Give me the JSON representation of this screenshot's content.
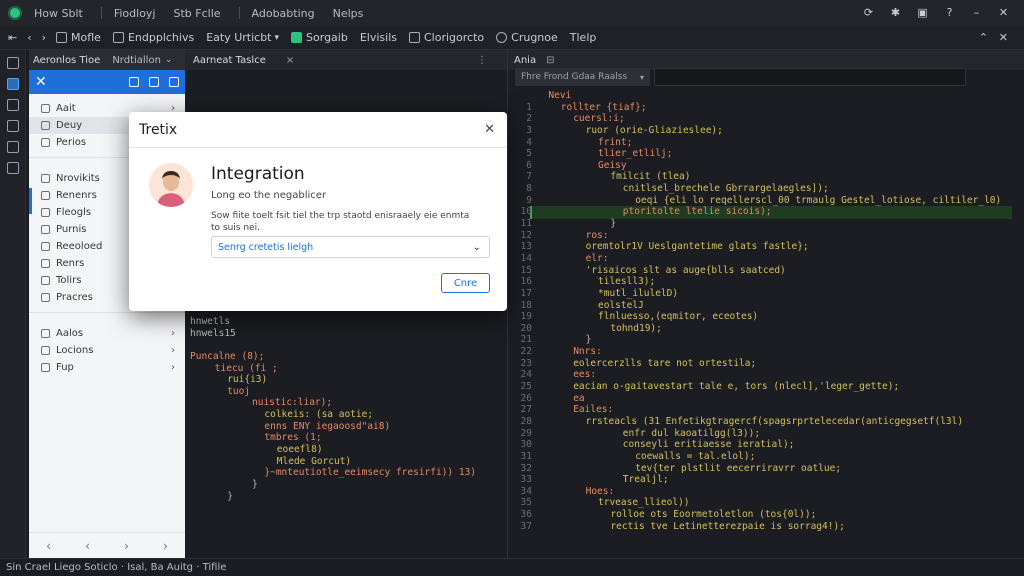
{
  "menubar": {
    "items": [
      "How Sblt",
      "Fiodloyj",
      "Stb Fclle",
      "Adobabting",
      "Nelps"
    ]
  },
  "toolbar": {
    "items": [
      "Mofle",
      "Endpplchivs",
      "Eaty Urticbt",
      "Sorgaib",
      "Elvisils",
      "Clorigorcto",
      "Crugnoe",
      "Tlelp"
    ]
  },
  "left_panel": {
    "tab1": "Aeronlos Tioe",
    "tab2": "Nrdtiallon",
    "items_a": [
      "Aait",
      "Deuy",
      "Perios"
    ],
    "items_b": [
      "Nrovikits",
      "Renenrs",
      "Fleogls",
      "Purnis",
      "Reeoloed",
      "Renrs",
      "Tolirs",
      "Pracres"
    ],
    "items_c": [
      "Aalos",
      "Locions",
      "Fup"
    ]
  },
  "mid_pane": {
    "tab": "Aarneat Taslce",
    "code": [
      {
        "t": "hnwetls",
        "i": 0,
        "c": "#b7bbc2"
      },
      {
        "t": "hnwels15",
        "i": 0,
        "c": "#b7bbc2"
      },
      {
        "t": "",
        "i": 0,
        "c": "#b7bbc2"
      },
      {
        "t": "Puncalne (8);",
        "i": 0,
        "c": "#e58b62"
      },
      {
        "t": "tiecu (fi ;",
        "i": 2,
        "c": "#e58b62"
      },
      {
        "t": "rui{i3)",
        "i": 3,
        "c": "#d4c05a"
      },
      {
        "t": "tuoj",
        "i": 3,
        "c": "#e58b62"
      },
      {
        "t": "nuistic:liar);",
        "i": 5,
        "c": "#e58b62"
      },
      {
        "t": "colkeis: (sa aotie;",
        "i": 6,
        "c": "#d4c05a"
      },
      {
        "t": "enns ENY iegaoosd\"ai8)",
        "i": 6,
        "c": "#e58b62"
      },
      {
        "t": "tmbres (1;",
        "i": 6,
        "c": "#e58b62"
      },
      {
        "t": "eoeefl8)",
        "i": 7,
        "c": "#d4c05a"
      },
      {
        "t": "Mlede Gorcut)",
        "i": 7,
        "c": "#d4c05a"
      },
      {
        "t": "}~mnteutiotle_eeimsecy fresirfi)) 13)",
        "i": 6,
        "c": "#e58b62"
      },
      {
        "t": "}",
        "i": 5,
        "c": "#b7bbc2"
      },
      {
        "t": "}",
        "i": 3,
        "c": "#b7bbc2"
      }
    ]
  },
  "right_pane": {
    "tab": "Ania",
    "filter_label": "Fhre Frond Gdaa Raalss",
    "code": [
      {
        "n": "",
        "t": "Nevi",
        "i": 1,
        "c": "#e58b62"
      },
      {
        "n": "1",
        "t": "rollter {tiaf};",
        "i": 2,
        "c": "#e58b62"
      },
      {
        "n": "2",
        "t": "cuersl:i;",
        "i": 3,
        "c": "#e58b62"
      },
      {
        "n": "3",
        "t": "ruor (orie-Gliazieslee);",
        "i": 4,
        "c": "#d4c05a"
      },
      {
        "n": "4",
        "t": "frint;",
        "i": 5,
        "c": "#e58b62"
      },
      {
        "n": "5",
        "t": "tlier_etlilj;",
        "i": 5,
        "c": "#e58b62"
      },
      {
        "n": "6",
        "t": "Geisy",
        "i": 5,
        "c": "#e58b62"
      },
      {
        "n": "7",
        "t": "fmilcit (tlea)",
        "i": 6,
        "c": "#d4c05a"
      },
      {
        "n": "8",
        "t": "cnitlsel_brechele Gbrrargelaegles]);",
        "i": 7,
        "c": "#d4c05a"
      },
      {
        "n": "9",
        "t": "oeqi {eli lo reqellerscl_00 trmaulg Gestel_lotiose, ciltiler_l0)",
        "i": 8,
        "c": "#d4c05a"
      },
      {
        "n": "10",
        "t": "ptoritolte ltelie sicois);",
        "i": 7,
        "c": "#e58b62"
      },
      {
        "n": "11",
        "t": "}",
        "i": 6,
        "c": "#b7bbc2"
      },
      {
        "n": "12",
        "t": "ros:",
        "i": 4,
        "c": "#e58b62"
      },
      {
        "n": "13",
        "t": "oremtolr1V Ueslgantetime glats fastle};",
        "i": 4,
        "c": "#d4c05a"
      },
      {
        "n": "14",
        "t": "elr:",
        "i": 4,
        "c": "#e58b62"
      },
      {
        "n": "15",
        "t": "'risaicos slt as auge{blls saatced)",
        "i": 4,
        "c": "#d4c05a"
      },
      {
        "n": "16",
        "t": "tilesll3);",
        "i": 5,
        "c": "#d4c05a"
      },
      {
        "n": "17",
        "t": "*mutl_ilulelD)",
        "i": 5,
        "c": "#d4c05a"
      },
      {
        "n": "18",
        "t": "eolstelJ",
        "i": 5,
        "c": "#d4c05a"
      },
      {
        "n": "19",
        "t": "flnluesso,(eqmitor, eceotes)",
        "i": 5,
        "c": "#d4c05a"
      },
      {
        "n": "20",
        "t": "tohnd19);",
        "i": 6,
        "c": "#d4c05a"
      },
      {
        "n": "21",
        "t": "}",
        "i": 4,
        "c": "#b7bbc2"
      },
      {
        "n": "22",
        "t": "Nnrs:",
        "i": 3,
        "c": "#e58b62"
      },
      {
        "n": "23",
        "t": "eolercerzlls tare not ortestila;",
        "i": 3,
        "c": "#d4c05a"
      },
      {
        "n": "24",
        "t": "ees:",
        "i": 3,
        "c": "#e58b62"
      },
      {
        "n": "25",
        "t": "eacian o-gaitavestart tale e, tors (nlecl],'leger_gette);",
        "i": 3,
        "c": "#d4c05a"
      },
      {
        "n": "26",
        "t": "ea",
        "i": 3,
        "c": "#e58b62"
      },
      {
        "n": "27",
        "t": "Eailes:",
        "i": 3,
        "c": "#e58b62"
      },
      {
        "n": "28",
        "t": "rrsteacls (31 Enfetikgtragercf(spagsrprtelecedar(anticgegsetf(l3l)",
        "i": 4,
        "c": "#d4c05a"
      },
      {
        "n": "29",
        "t": "enfr dul kaoatilgg(l3));",
        "i": 7,
        "c": "#d4c05a"
      },
      {
        "n": "30",
        "t": "conseyli eritiaesse ieratial);",
        "i": 7,
        "c": "#d4c05a"
      },
      {
        "n": "31",
        "t": "coewalls = tal.elol);",
        "i": 8,
        "c": "#d4c05a"
      },
      {
        "n": "32",
        "t": "tev{ter plstlit eecerriravrr oatlue;",
        "i": 8,
        "c": "#d4c05a"
      },
      {
        "n": "33",
        "t": "Trealjl;",
        "i": 7,
        "c": "#d4c05a"
      },
      {
        "n": "34",
        "t": "Hoes:",
        "i": 4,
        "c": "#e58b62"
      },
      {
        "n": "35",
        "t": "trvease_llieol))",
        "i": 5,
        "c": "#d4c05a"
      },
      {
        "n": "36",
        "t": "rolloe ots Eoormetoletlon (tos{0l));",
        "i": 6,
        "c": "#d4c05a"
      },
      {
        "n": "37",
        "t": "rectis tve Letinetterezpaie is sorrag4!);",
        "i": 6,
        "c": "#d4c05a"
      }
    ]
  },
  "dialog": {
    "header": "Tretix",
    "title": "Integration",
    "subtitle": "Long eo the negablicer",
    "description": "Sow fiite toelt fsit tiel the trp staotd enisraaely eie enmta to suis nei.",
    "select_value": "Senrg cretetis lielgh",
    "button_label": "Cnre"
  },
  "status": {
    "text": "Sin Crael Liego Soticlo · Isal, Ba Auitg · Tifile"
  }
}
